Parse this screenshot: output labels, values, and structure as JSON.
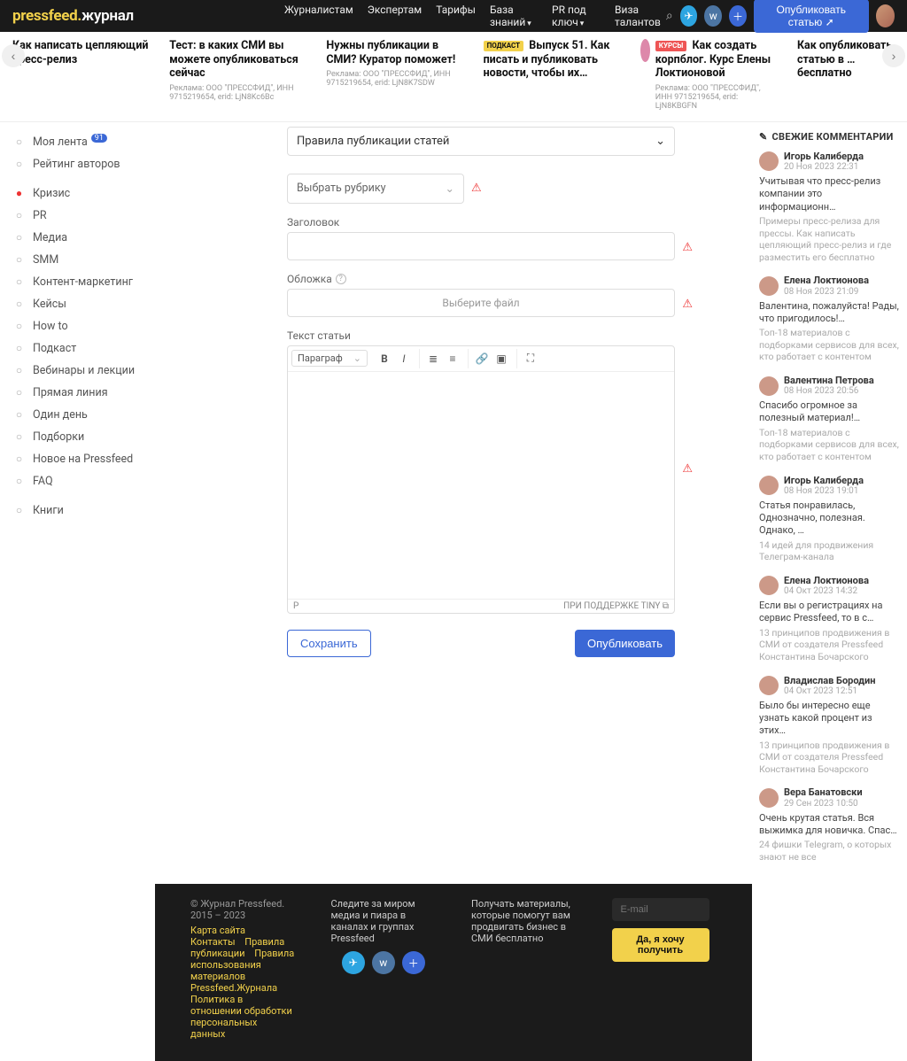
{
  "header": {
    "logo_left": "pressfeed.",
    "logo_right": "журнал",
    "nav": {
      "journalists": "Журналистам",
      "experts": "Экспертам",
      "tariffs": "Тарифы",
      "kb": "База знаний",
      "pr": "PR под ключ",
      "visa": "Виза талантов"
    },
    "publish_btn": "Опубликовать статью"
  },
  "features": [
    {
      "title": "Как написать цепляющий пресс-релиз",
      "sub": ""
    },
    {
      "title": "Тест: в каких СМИ вы можете опубликоваться сейчас",
      "sub": "Реклама: ООО \"ПРЕССФИД\", ИНН 9715219654, erid: LjN8Kc6Bc"
    },
    {
      "title": "Нужны публикации в СМИ? Куратор поможет!",
      "sub": "Реклама: ООО \"ПРЕССФИД\", ИНН 9715219654, erid: LjN8K7SDW"
    },
    {
      "pill": "ПОДКАСТ",
      "title": "Выпуск 51. Как писать и публиковать новости, чтобы их…",
      "sub": ""
    },
    {
      "pill": "КУРСЫ",
      "title": "Как создать корпблог. Курс Елены Локтионовой",
      "sub": "Реклама: ООО \"ПРЕССФИД\", ИНН 9715219654, erid: LjN8KBGFN",
      "avatar": true
    },
    {
      "title": "Как опубликовать статью в … бесплатно",
      "sub": ""
    }
  ],
  "sidebar": {
    "items": [
      {
        "label": "Моя лента",
        "badge": "91"
      },
      {
        "label": "Рейтинг авторов"
      },
      {
        "sep": true
      },
      {
        "label": "Кризис",
        "alert": true
      },
      {
        "label": "PR"
      },
      {
        "label": "Медиа"
      },
      {
        "label": "SMM"
      },
      {
        "label": "Контент-маркетинг"
      },
      {
        "label": "Кейсы"
      },
      {
        "label": "How to"
      },
      {
        "label": "Подкаст"
      },
      {
        "label": "Вебинары и лекции"
      },
      {
        "label": "Прямая линия"
      },
      {
        "label": "Один день"
      },
      {
        "label": "Подборки"
      },
      {
        "label": "Новое на Pressfeed"
      },
      {
        "label": "FAQ"
      },
      {
        "sep": true
      },
      {
        "label": "Книги"
      }
    ]
  },
  "form": {
    "rules": "Правила публикации статей",
    "rubric_placeholder": "Выбрать рубрику",
    "title_label": "Заголовок",
    "cover_label": "Обложка",
    "cover_btn": "Выберите файл",
    "body_label": "Текст статьи",
    "fmt": "Параграф",
    "status_path": "P",
    "tiny": "ПРИ ПОДДЕРЖКЕ TINY",
    "save": "Сохранить",
    "publish": "Опубликовать"
  },
  "comments": {
    "heading": "СВЕЖИЕ КОММЕНТАРИИ",
    "items": [
      {
        "name": "Игорь Калиберда",
        "date": "20 Ноя 2023 22:31",
        "body": "Учитывая что пресс-релиз компании это информационн…",
        "tail": "Примеры пресс-релиза для прессы. Как написать цепляющий пресс-релиз и где разместить его бесплатно"
      },
      {
        "name": "Елена Локтионова",
        "date": "08 Ноя 2023 21:09",
        "body": "Валентина, пожалуйста! Рады, что пригодилось!…",
        "tail": "Топ-18 материалов с подборками сервисов для всех, кто работает с контентом"
      },
      {
        "name": "Валентина Петрова",
        "date": "08 Ноя 2023 20:56",
        "body": "Спасибо огромное за полезный материал!…",
        "tail": "Топ-18 материалов с подборками сервисов для всех, кто работает с контентом"
      },
      {
        "name": "Игорь Калиберда",
        "date": "08 Ноя 2023 19:01",
        "body": "Статья понравилась, Однозначно, полезная. Однако, …",
        "tail": "14 идей для продвижения Телеграм-канала"
      },
      {
        "name": "Елена Локтионова",
        "date": "04 Окт 2023 14:32",
        "body": "Если вы о регистрациях на сервис Pressfeed, то в с…",
        "tail": "13 принципов продвижения в СМИ от создателя Pressfeed Константина Бочарского"
      },
      {
        "name": "Владислав Бородин",
        "date": "04 Окт 2023 12:51",
        "body": "Было бы интересно еще узнать какой процент из этих…",
        "tail": "13 принципов продвижения в СМИ от создателя Pressfeed Константина Бочарского"
      },
      {
        "name": "Вера Банатовски",
        "date": "29 Сен 2023 10:50",
        "body": "Очень крутая статья. Вся выжимка для новичка. Спас…",
        "tail": "24 фишки Telegram, о которых знают не все"
      }
    ]
  },
  "footer": {
    "copyright": "© Журнал Pressfeed. 2015 – 2023",
    "links": {
      "map": "Карта сайта",
      "contacts": "Контакты",
      "rules": "Правила публикации",
      "tos": "Правила использования материалов Pressfeed.Журнала",
      "privacy": "Политика в отношении обработки персональных данных"
    },
    "follow": "Следите за миром медиа и пиара в каналах и группах Pressfeed",
    "promo": "Получать материалы, которые помогут вам продвигать бизнес в СМИ бесплатно",
    "email_ph": "E-mail",
    "subscribe": "Да, я хочу получить"
  }
}
